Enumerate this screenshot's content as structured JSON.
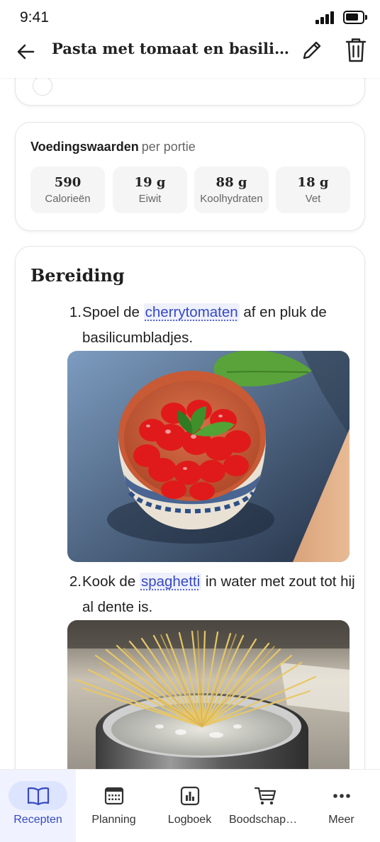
{
  "status_bar": {
    "time": "9:41"
  },
  "app_bar": {
    "title": "Pasta met tomaat en basilicum",
    "back_icon": "arrow-left-icon",
    "edit_icon": "pencil-icon",
    "delete_icon": "trash-icon"
  },
  "nutrition": {
    "title": "Voedingswaarden",
    "subtitle": "per portie",
    "stats": [
      {
        "value": "590",
        "label": "Calorieën"
      },
      {
        "value": "19 g",
        "label": "Eiwit"
      },
      {
        "value": "88 g",
        "label": "Koolhydraten"
      },
      {
        "value": "18 g",
        "label": "Vet"
      }
    ]
  },
  "preparation": {
    "title": "Bereiding",
    "steps": [
      {
        "number": "1.",
        "text_before": "Spoel de",
        "ingredient": "cherrytomaten",
        "text_after": "af en pluk de basilicumbladjes.",
        "image": "cherry-tomatoes-bowl-photo"
      },
      {
        "number": "2.",
        "text_before": "Kook de",
        "ingredient": "spaghetti",
        "text_after": "in water met zout tot hij al dente is.",
        "image": "spaghetti-in-pot-photo"
      }
    ]
  },
  "bottom_nav": {
    "active": "Recepten",
    "items": [
      {
        "label": "Recepten",
        "icon": "book-icon"
      },
      {
        "label": "Planning",
        "icon": "calendar-icon"
      },
      {
        "label": "Logboek",
        "icon": "chart-icon"
      },
      {
        "label": "Boodschappen",
        "icon": "cart-icon"
      },
      {
        "label": "Meer",
        "icon": "more-icon"
      }
    ]
  },
  "colors": {
    "accent": "#3549c4",
    "nav_active_bg": "#f0f3ff",
    "nav_pill": "#dde4fd",
    "link_bg": "#eef0fb"
  }
}
